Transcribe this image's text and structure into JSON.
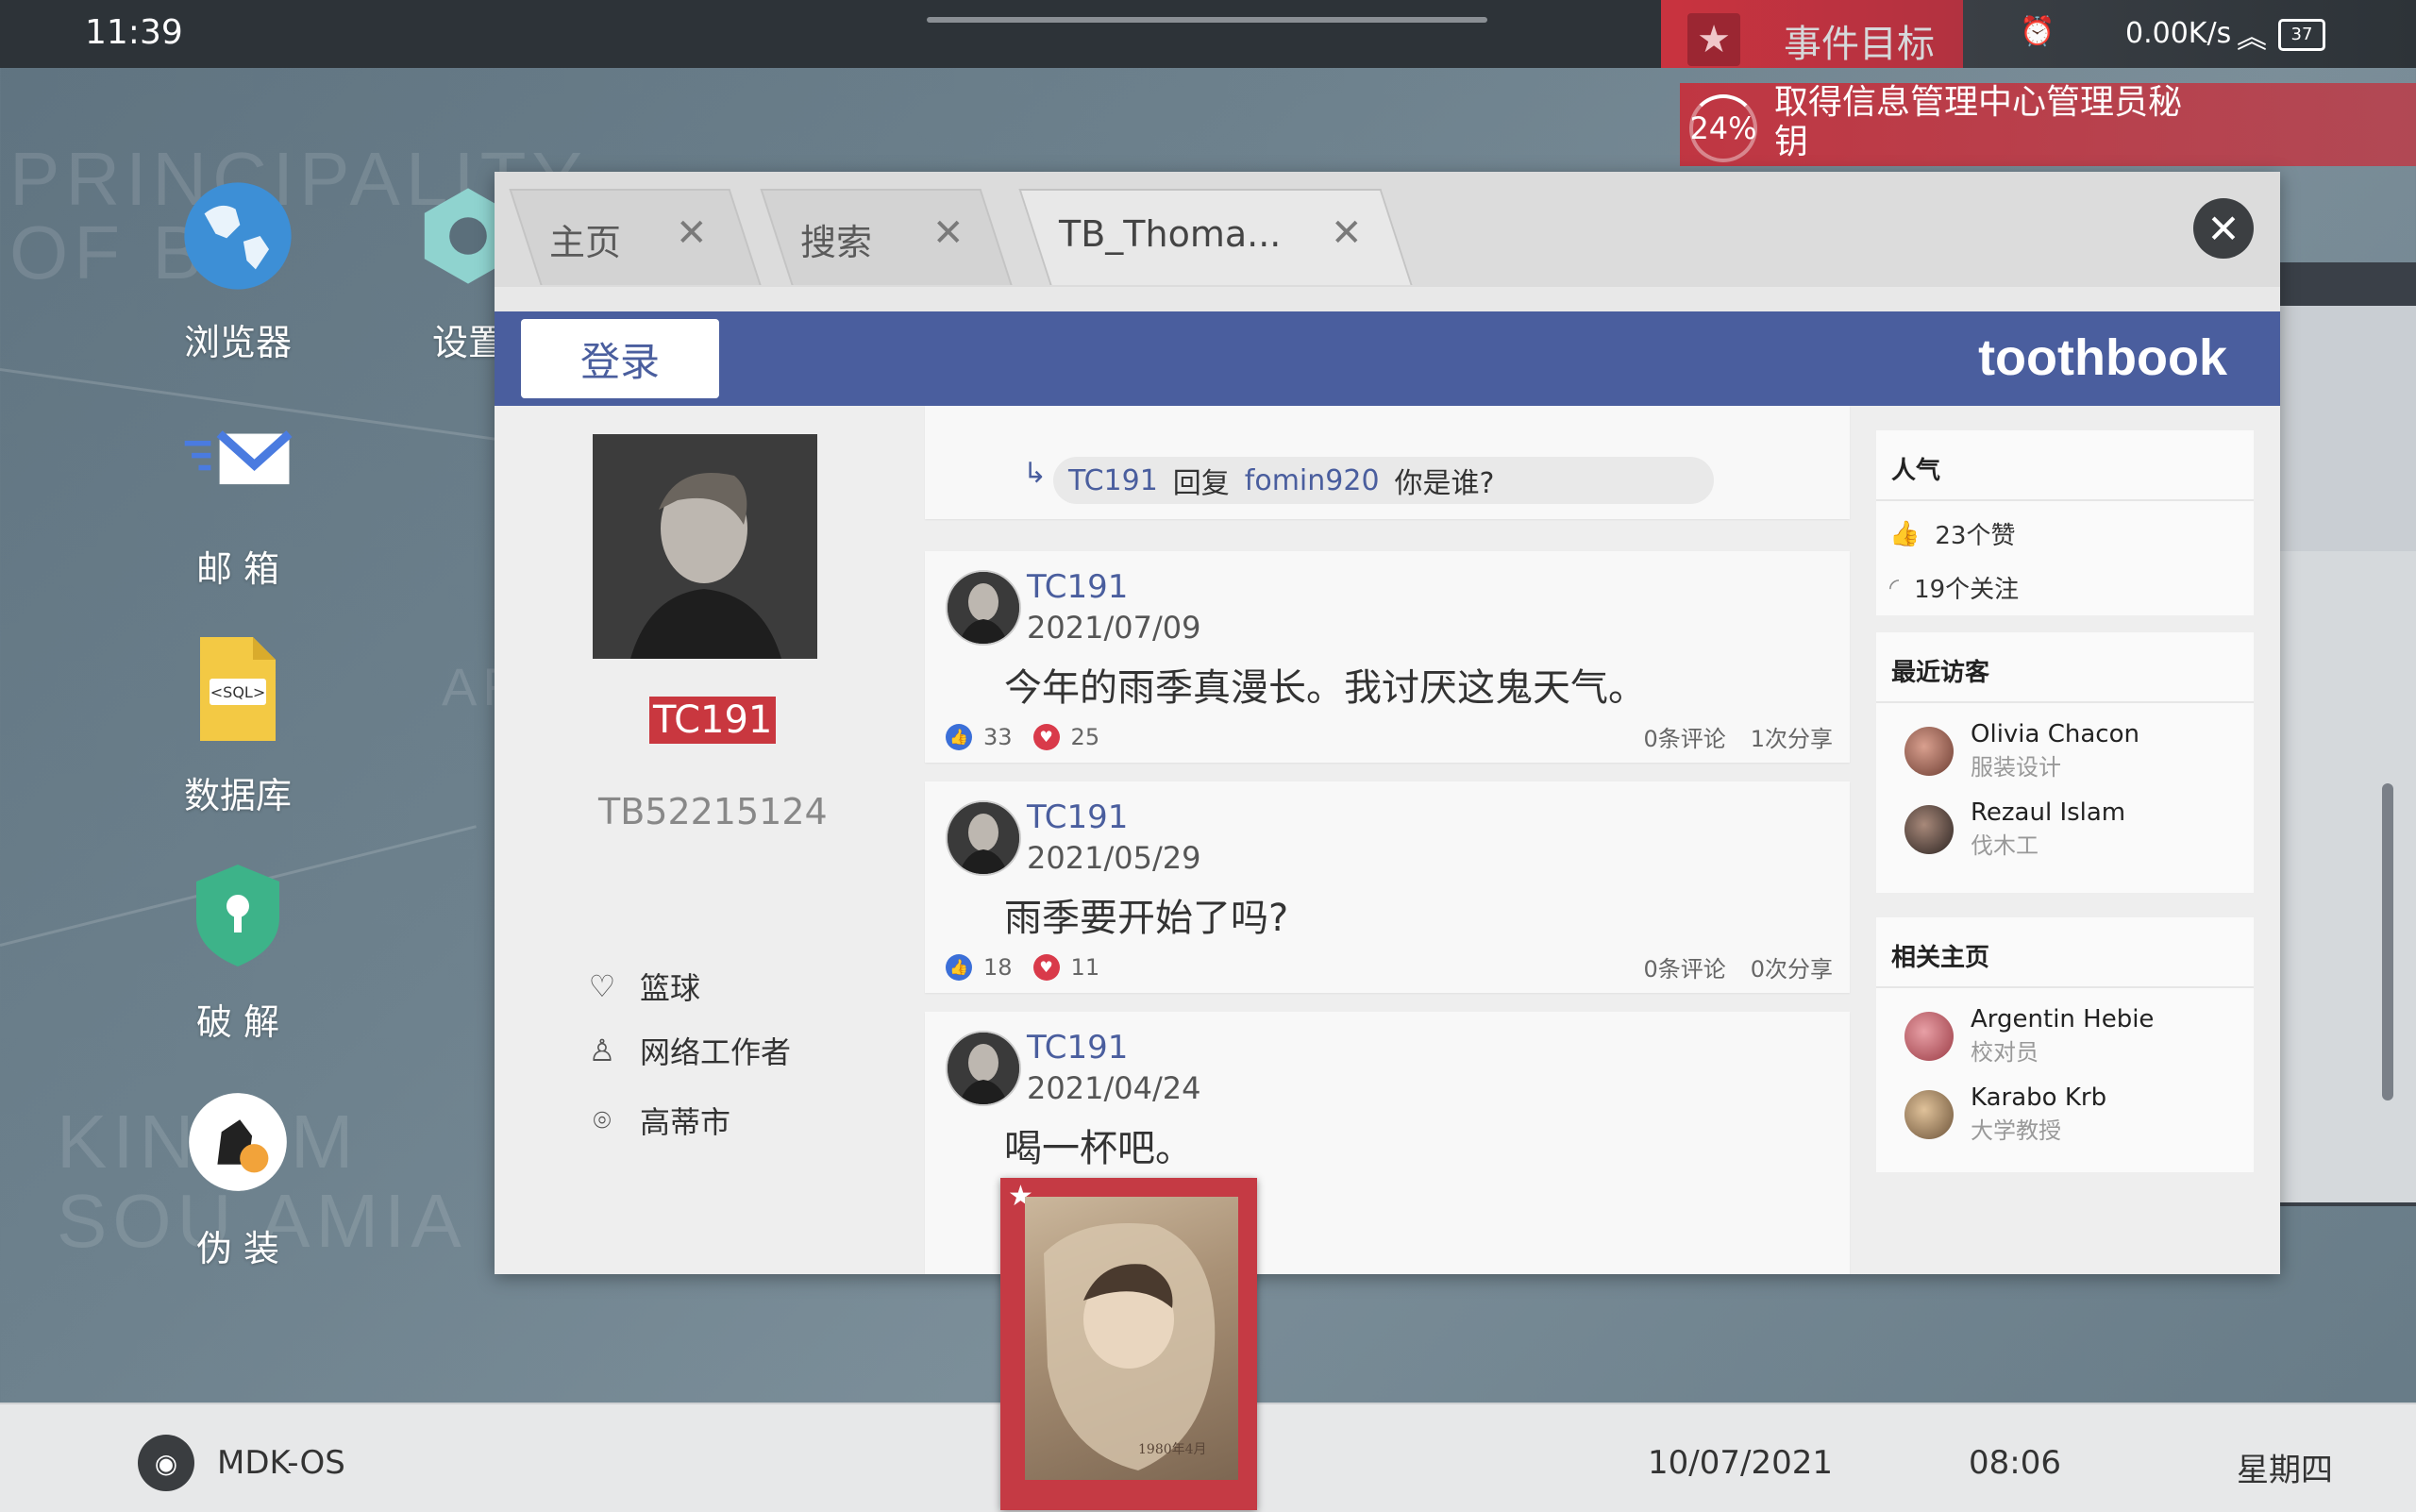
{
  "status": {
    "time": "11:39",
    "net_speed": "0.00K/s",
    "battery": "37"
  },
  "mission": {
    "header": "事件目标",
    "progress_label": "24%",
    "description": "取得信息管理中心管理员秘钥"
  },
  "desktop": {
    "icons": [
      {
        "label": "浏览器"
      },
      {
        "label": "设置"
      },
      {
        "label": "邮 箱"
      },
      {
        "label": "数据库"
      },
      {
        "label": "破 解"
      },
      {
        "label": "伪 装"
      }
    ],
    "sql_tag": "<SQL>",
    "map_text": [
      "PRINCIPALITY",
      "OF B",
      "KIN   OM",
      "SOU  AMIA",
      "AR"
    ]
  },
  "browser": {
    "tabs": [
      {
        "label": "主页"
      },
      {
        "label": "搜索"
      },
      {
        "label": "TB_Thoma..."
      }
    ],
    "login_label": "登录",
    "brand": "toothbook"
  },
  "profile": {
    "name": "TC191",
    "id": "TB52215124",
    "interest": "篮球",
    "job": "网络工作者",
    "city": "高蒂市"
  },
  "reply": {
    "user": "TC191",
    "verb": "回复",
    "target": "fomin920",
    "text": "你是谁?"
  },
  "posts": [
    {
      "user": "TC191",
      "date": "2021/07/09",
      "text": "今年的雨季真漫长。我讨厌这鬼天气。",
      "likes": "33",
      "hearts": "25",
      "comments": "0条评论",
      "shares": "1次分享"
    },
    {
      "user": "TC191",
      "date": "2021/05/29",
      "text": "雨季要开始了吗?",
      "likes": "18",
      "hearts": "11",
      "comments": "0条评论",
      "shares": "0次分享"
    },
    {
      "user": "TC191",
      "date": "2021/04/24",
      "text": "喝一杯吧。"
    }
  ],
  "sidebar": {
    "popularity_title": "人气",
    "likes": "23个赞",
    "follows": "19个关注",
    "visitors_title": "最近访客",
    "visitors": [
      {
        "name": "Olivia Chacon",
        "role": "服装设计"
      },
      {
        "name": "Rezaul Islam",
        "role": "伐木工"
      }
    ],
    "related_title": "相关主页",
    "related": [
      {
        "name": "Argentin Hebie",
        "role": "校对员"
      },
      {
        "name": "Karabo Krb",
        "role": "大学教授"
      }
    ]
  },
  "taskbar": {
    "os_name": "MDK-OS",
    "date": "10/07/2021",
    "time": "08:06",
    "weekday": "星期四"
  },
  "photo": {
    "inscription": "1980年4月"
  },
  "colors": {
    "brand_blue": "#4a5e9e",
    "mission_red": "#c9333f",
    "highlight_red": "#c9373f"
  }
}
